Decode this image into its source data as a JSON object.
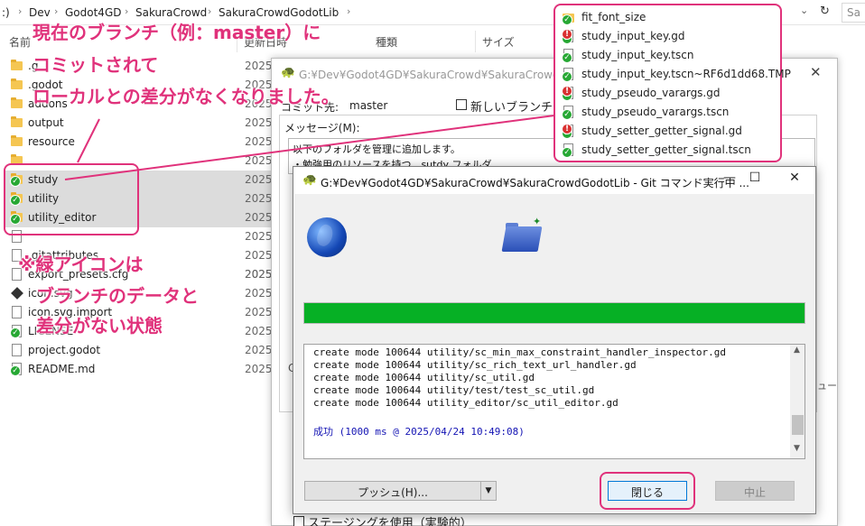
{
  "explorer": {
    "breadcrumb": [
      ":)",
      "Dev",
      "Godot4GD",
      "SakuraCrowd",
      "SakuraCrowdGodotLib"
    ],
    "search_placeholder": "Sa",
    "columns": [
      "名前",
      "更新日時",
      "種類",
      "サイズ"
    ],
    "rows": [
      {
        "name": ".g",
        "date": "2025",
        "icon": "folder-icon",
        "selected": false
      },
      {
        "name": ".godot",
        "date": "2025",
        "icon": "folder-icon",
        "selected": false
      },
      {
        "name": "addons",
        "date": "2025",
        "icon": "folder-icon",
        "selected": false
      },
      {
        "name": "output",
        "date": "2025",
        "icon": "folder-icon",
        "selected": false
      },
      {
        "name": "resource",
        "date": "2025",
        "icon": "folder-icon",
        "selected": false
      },
      {
        "name": "",
        "date": "2025",
        "icon": "folder-icon",
        "selected": false
      },
      {
        "name": "study",
        "date": "2025",
        "icon": "folder-git-clean-icon",
        "selected": true
      },
      {
        "name": "utility",
        "date": "2025",
        "icon": "folder-git-clean-icon",
        "selected": true
      },
      {
        "name": "utility_editor",
        "date": "2025",
        "icon": "folder-git-clean-icon",
        "selected": true
      },
      {
        "name": "",
        "date": "2025",
        "icon": "file-icon",
        "selected": false
      },
      {
        "name": ".gitattributes",
        "date": "2025",
        "icon": "file-icon",
        "selected": false
      },
      {
        "name": "",
        "date": "2025",
        "icon": "file-icon",
        "selected": false
      },
      {
        "name": "export_presets.cfg",
        "date": "2025",
        "icon": "settings-file-icon",
        "selected": false
      },
      {
        "name": "icon.svg",
        "date": "2025",
        "icon": "godot-icon",
        "selected": false
      },
      {
        "name": "icon.svg.import",
        "date": "2025",
        "icon": "file-icon",
        "selected": false
      },
      {
        "name": "LICENSE",
        "date": "2025",
        "icon": "file-git-clean-icon",
        "selected": false
      },
      {
        "name": "project.godot",
        "date": "2025",
        "icon": "file-icon",
        "selected": false
      },
      {
        "name": "README.md",
        "date": "2025",
        "icon": "file-git-clean-icon",
        "selected": false
      }
    ]
  },
  "commit_dialog": {
    "title": "G:¥Dev¥Godot4GD¥SakuraCrowd¥SakuraCrowdGodotLib - コミット",
    "commit_to_label": "コミット先:",
    "branch": "master",
    "new_branch_label": "新しいブランチ",
    "message_label": "メッセージ(M):",
    "message_lines": [
      "以下のフォルダを管理に追加します。",
      "・勉強用のリソースを持つ　sutdy フォルダ"
    ],
    "staging_label": "ステージングを使用（実験的）",
    "left_fragment": "C",
    "right_fragment": "ュー"
  },
  "progress_dialog": {
    "title": "G:¥Dev¥Godot4GD¥SakuraCrowd¥SakuraCrowdGodotLib - Git コマンド実行中 ...",
    "progress_percent": 100,
    "progress_color": "#06b025",
    "log_lines": [
      "create mode 100644 utility/sc_min_max_constraint_handler_inspector.gd",
      "create mode 100644 utility/sc_rich_text_url_handler.gd",
      "create mode 100644 utility/sc_util.gd",
      "create mode 100644 utility/test/test_sc_util.gd",
      "create mode 100644 utility_editor/sc_util_editor.gd"
    ],
    "success_line": "成功 (1000 ms @ 2025/04/24 10:49:08)",
    "push_label": "プッシュ(H)...",
    "close_label": "閉じる",
    "abort_label": "中止"
  },
  "annotation": {
    "color": "#e0327b",
    "callout_top": [
      "現在のブランチ（例：master）に",
      "コミットされて",
      "ローカルとの差分がなくなりました。"
    ],
    "callout_bottom": [
      "※緑アイコンは",
      "ブランチのデータと",
      "差分がない状態"
    ],
    "file_list": [
      {
        "name": "fit_font_size",
        "icon": "folder-git-clean-icon"
      },
      {
        "name": "study_input_key.gd",
        "icon": "file-git-modified-icon"
      },
      {
        "name": "study_input_key.tscn",
        "icon": "file-git-clean-icon"
      },
      {
        "name": "study_input_key.tscn~RF6d1dd68.TMP",
        "icon": "file-git-clean-icon"
      },
      {
        "name": "study_pseudo_varargs.gd",
        "icon": "file-git-modified-icon"
      },
      {
        "name": "study_pseudo_varargs.tscn",
        "icon": "file-git-clean-icon"
      },
      {
        "name": "study_setter_getter_signal.gd",
        "icon": "file-git-modified-icon"
      },
      {
        "name": "study_setter_getter_signal.tscn",
        "icon": "file-git-clean-icon"
      }
    ]
  }
}
